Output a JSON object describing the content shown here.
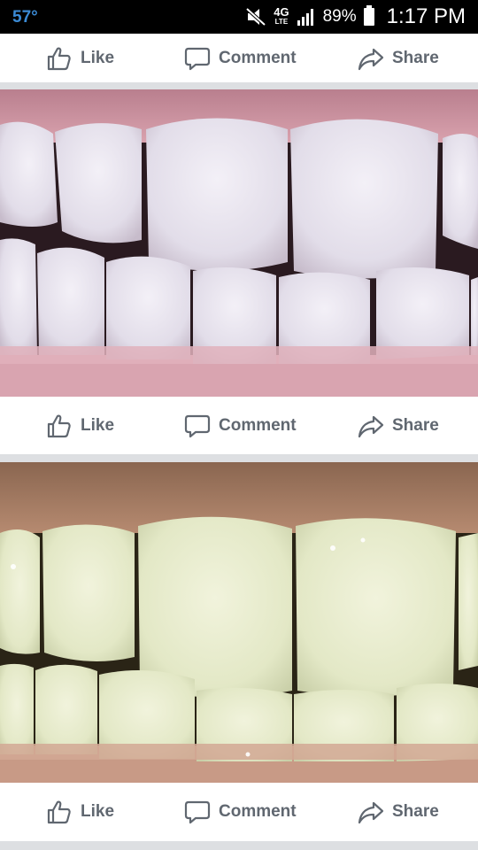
{
  "status_bar": {
    "temperature": "57°",
    "network": "4G",
    "network_sub": "LTE",
    "battery": "89%",
    "time": "1:17 PM"
  },
  "actions": {
    "like": "Like",
    "comment": "Comment",
    "share": "Share"
  },
  "icons": {
    "like": "thumbs-up-icon",
    "comment": "speech-bubble-icon",
    "share": "share-arrow-icon",
    "mute": "mute-icon",
    "signal": "signal-icon",
    "battery": "battery-icon"
  },
  "colors": {
    "action_text": "#606770",
    "temperature": "#3b8bd6",
    "feed_background": "#e9ebee"
  }
}
